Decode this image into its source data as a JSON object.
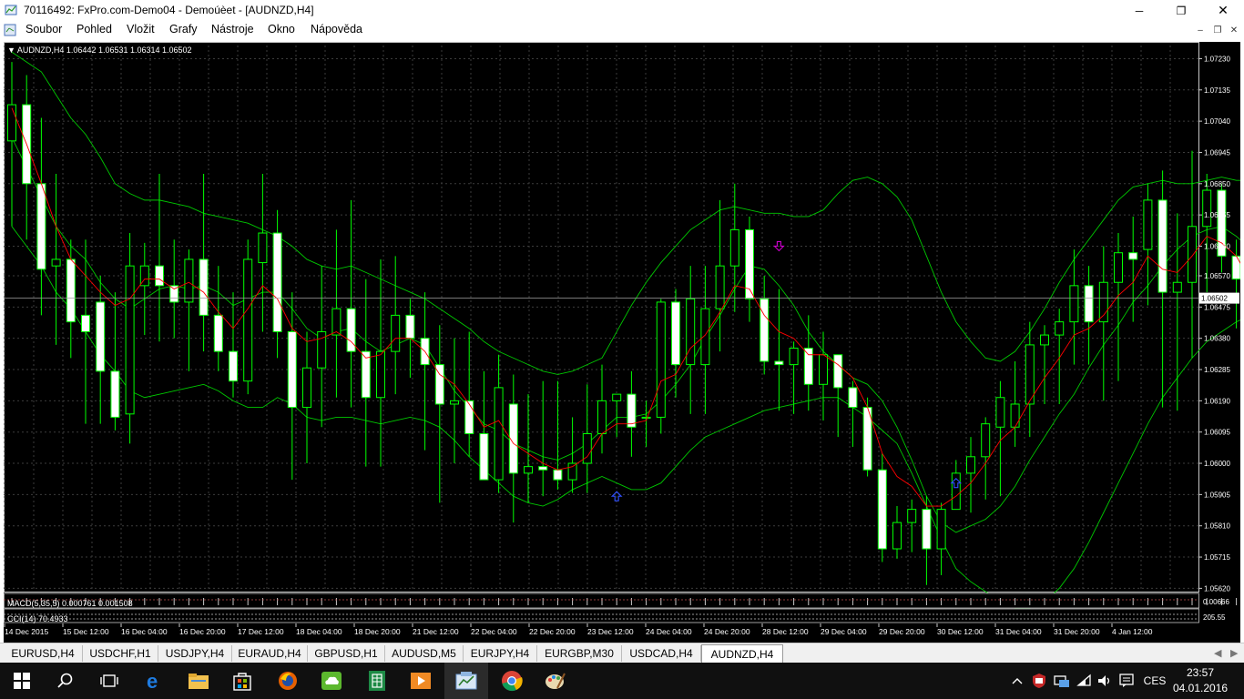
{
  "window": {
    "title": "70116492: FxPro.com-Demo04 - Demoúèet - [AUDNZD,H4]",
    "minimize": "─",
    "restore": "❐",
    "close": "✕"
  },
  "menu": {
    "items": [
      "Soubor",
      "Pohled",
      "Vložit",
      "Grafy",
      "Nástroje",
      "Okno",
      "Nápověda"
    ],
    "mdi_minimize": "–",
    "mdi_restore": "❐",
    "mdi_close": "✕"
  },
  "chart": {
    "header": "▼ AUDNZD,H4  1.06442 1.06531 1.06314 1.06502",
    "symbol": "AUDNZD",
    "timeframe": "H4",
    "ohlc": {
      "open": 1.06442,
      "high": 1.06531,
      "low": 1.06314,
      "close": 1.06502
    },
    "current_price_label": "1.06502",
    "macd_label": "MACD(5,35,5) 0.000761 0.001508",
    "cci_label": "CCI(14) 70.4933",
    "macd_scale": "0.00666",
    "cci_scale": "205.55",
    "colors": {
      "background": "#000000",
      "grid": "#3c3c3c",
      "candle": "#00ff00",
      "bull_body": "#000000",
      "bear_body": "#ffffff",
      "moving_average": "#ff0000",
      "bands": "#00c800",
      "arrow_up": "#3050ff",
      "arrow_down": "#d000d0",
      "text": "#ffffff"
    }
  },
  "chart_data": {
    "type": "candlestick",
    "title": "AUDNZD,H4",
    "y_ticks": [
      "1.07230",
      "1.07135",
      "1.07040",
      "1.06945",
      "1.06850",
      "1.06755",
      "1.06660",
      "1.06570",
      "1.06475",
      "1.06380",
      "1.06285",
      "1.06190",
      "1.06095",
      "1.06000",
      "1.05905",
      "1.05810",
      "1.05715",
      "1.05620"
    ],
    "ylim": [
      1.0561,
      1.0727
    ],
    "x_ticks": [
      "14 Dec 2015",
      "15 Dec 12:00",
      "16 Dec 04:00",
      "16 Dec 20:00",
      "17 Dec 12:00",
      "18 Dec 04:00",
      "18 Dec 20:00",
      "21 Dec 12:00",
      "22 Dec 04:00",
      "22 Dec 20:00",
      "23 Dec 12:00",
      "24 Dec 04:00",
      "24 Dec 20:00",
      "28 Dec 12:00",
      "29 Dec 04:00",
      "29 Dec 20:00",
      "30 Dec 12:00",
      "31 Dec 04:00",
      "31 Dec 20:00",
      "4 Jan 12:00"
    ],
    "candles": [
      {
        "o": 1.0698,
        "h": 1.0722,
        "l": 1.0672,
        "c": 1.0709
      },
      {
        "o": 1.0709,
        "h": 1.0718,
        "l": 1.0668,
        "c": 1.0685
      },
      {
        "o": 1.0685,
        "h": 1.0705,
        "l": 1.0645,
        "c": 1.0659
      },
      {
        "o": 1.066,
        "h": 1.0688,
        "l": 1.0636,
        "c": 1.0662
      },
      {
        "o": 1.0662,
        "h": 1.0668,
        "l": 1.0632,
        "c": 1.0643
      },
      {
        "o": 1.0645,
        "h": 1.0668,
        "l": 1.0612,
        "c": 1.064
      },
      {
        "o": 1.0649,
        "h": 1.0657,
        "l": 1.0612,
        "c": 1.0628
      },
      {
        "o": 1.0628,
        "h": 1.0652,
        "l": 1.061,
        "c": 1.0614
      },
      {
        "o": 1.0615,
        "h": 1.067,
        "l": 1.0606,
        "c": 1.066
      },
      {
        "o": 1.0654,
        "h": 1.0667,
        "l": 1.0639,
        "c": 1.066
      },
      {
        "o": 1.066,
        "h": 1.0688,
        "l": 1.0637,
        "c": 1.0654
      },
      {
        "o": 1.0654,
        "h": 1.0668,
        "l": 1.0638,
        "c": 1.0649
      },
      {
        "o": 1.0649,
        "h": 1.0665,
        "l": 1.0628,
        "c": 1.0662
      },
      {
        "o": 1.0662,
        "h": 1.0688,
        "l": 1.0634,
        "c": 1.0645
      },
      {
        "o": 1.0645,
        "h": 1.066,
        "l": 1.0628,
        "c": 1.0634
      },
      {
        "o": 1.0634,
        "h": 1.0652,
        "l": 1.062,
        "c": 1.0625
      },
      {
        "o": 1.0625,
        "h": 1.0668,
        "l": 1.0621,
        "c": 1.0662
      },
      {
        "o": 1.0661,
        "h": 1.0688,
        "l": 1.064,
        "c": 1.067
      },
      {
        "o": 1.067,
        "h": 1.0677,
        "l": 1.0632,
        "c": 1.064
      },
      {
        "o": 1.064,
        "h": 1.0652,
        "l": 1.0595,
        "c": 1.0617
      },
      {
        "o": 1.0617,
        "h": 1.064,
        "l": 1.06,
        "c": 1.0629
      },
      {
        "o": 1.0629,
        "h": 1.066,
        "l": 1.0611,
        "c": 1.064
      },
      {
        "o": 1.0639,
        "h": 1.0671,
        "l": 1.062,
        "c": 1.0647
      },
      {
        "o": 1.0647,
        "h": 1.068,
        "l": 1.0617,
        "c": 1.0634
      },
      {
        "o": 1.0634,
        "h": 1.0656,
        "l": 1.0599,
        "c": 1.062
      },
      {
        "o": 1.062,
        "h": 1.0662,
        "l": 1.0599,
        "c": 1.0634
      },
      {
        "o": 1.0634,
        "h": 1.0663,
        "l": 1.0621,
        "c": 1.0645
      },
      {
        "o": 1.0645,
        "h": 1.065,
        "l": 1.0626,
        "c": 1.0638
      },
      {
        "o": 1.0638,
        "h": 1.0652,
        "l": 1.0604,
        "c": 1.063
      },
      {
        "o": 1.063,
        "h": 1.0642,
        "l": 1.0588,
        "c": 1.0618
      },
      {
        "o": 1.0618,
        "h": 1.0638,
        "l": 1.06,
        "c": 1.0619
      },
      {
        "o": 1.0619,
        "h": 1.064,
        "l": 1.0602,
        "c": 1.0609
      },
      {
        "o": 1.0609,
        "h": 1.0628,
        "l": 1.0598,
        "c": 1.0595
      },
      {
        "o": 1.0595,
        "h": 1.0633,
        "l": 1.0591,
        "c": 1.0623
      },
      {
        "o": 1.0618,
        "h": 1.0627,
        "l": 1.0582,
        "c": 1.0597
      },
      {
        "o": 1.0597,
        "h": 1.0621,
        "l": 1.0588,
        "c": 1.0599
      },
      {
        "o": 1.0599,
        "h": 1.0625,
        "l": 1.059,
        "c": 1.0598
      },
      {
        "o": 1.0598,
        "h": 1.0625,
        "l": 1.0592,
        "c": 1.0595
      },
      {
        "o": 1.0595,
        "h": 1.0614,
        "l": 1.0591,
        "c": 1.06
      },
      {
        "o": 1.06,
        "h": 1.0624,
        "l": 1.0591,
        "c": 1.0609
      },
      {
        "o": 1.0609,
        "h": 1.063,
        "l": 1.0603,
        "c": 1.0619
      },
      {
        "o": 1.0619,
        "h": 1.0621,
        "l": 1.0608,
        "c": 1.0621
      },
      {
        "o": 1.0621,
        "h": 1.0628,
        "l": 1.0602,
        "c": 1.0611
      },
      {
        "o": 1.0614,
        "h": 1.0619,
        "l": 1.0605,
        "c": 1.0614
      },
      {
        "o": 1.0614,
        "h": 1.065,
        "l": 1.0609,
        "c": 1.0649
      },
      {
        "o": 1.0649,
        "h": 1.0653,
        "l": 1.062,
        "c": 1.063
      },
      {
        "o": 1.063,
        "h": 1.066,
        "l": 1.0615,
        "c": 1.065
      },
      {
        "o": 1.063,
        "h": 1.066,
        "l": 1.0615,
        "c": 1.0647
      },
      {
        "o": 1.0647,
        "h": 1.068,
        "l": 1.0634,
        "c": 1.066
      },
      {
        "o": 1.066,
        "h": 1.0685,
        "l": 1.0646,
        "c": 1.0671
      },
      {
        "o": 1.0671,
        "h": 1.0675,
        "l": 1.0643,
        "c": 1.065
      },
      {
        "o": 1.065,
        "h": 1.0657,
        "l": 1.0627,
        "c": 1.0631
      },
      {
        "o": 1.0631,
        "h": 1.0653,
        "l": 1.0616,
        "c": 1.063
      },
      {
        "o": 1.063,
        "h": 1.0637,
        "l": 1.0615,
        "c": 1.0635
      },
      {
        "o": 1.0635,
        "h": 1.0645,
        "l": 1.0616,
        "c": 1.0624
      },
      {
        "o": 1.0624,
        "h": 1.064,
        "l": 1.0613,
        "c": 1.0633
      },
      {
        "o": 1.0633,
        "h": 1.063,
        "l": 1.0608,
        "c": 1.0623
      },
      {
        "o": 1.0623,
        "h": 1.0625,
        "l": 1.0605,
        "c": 1.0617
      },
      {
        "o": 1.0617,
        "h": 1.062,
        "l": 1.0596,
        "c": 1.0598
      },
      {
        "o": 1.0598,
        "h": 1.0603,
        "l": 1.057,
        "c": 1.0574
      },
      {
        "o": 1.0574,
        "h": 1.0587,
        "l": 1.0571,
        "c": 1.0582
      },
      {
        "o": 1.0582,
        "h": 1.0589,
        "l": 1.0573,
        "c": 1.0586
      },
      {
        "o": 1.0586,
        "h": 1.059,
        "l": 1.0563,
        "c": 1.0574
      },
      {
        "o": 1.0574,
        "h": 1.0588,
        "l": 1.0566,
        "c": 1.0586
      },
      {
        "o": 1.0586,
        "h": 1.0601,
        "l": 1.0586,
        "c": 1.0597
      },
      {
        "o": 1.0597,
        "h": 1.0608,
        "l": 1.0585,
        "c": 1.0602
      },
      {
        "o": 1.0602,
        "h": 1.0614,
        "l": 1.0589,
        "c": 1.0612
      },
      {
        "o": 1.0611,
        "h": 1.0625,
        "l": 1.059,
        "c": 1.062
      },
      {
        "o": 1.0611,
        "h": 1.0631,
        "l": 1.0605,
        "c": 1.0618
      },
      {
        "o": 1.0618,
        "h": 1.0643,
        "l": 1.0608,
        "c": 1.0636
      },
      {
        "o": 1.0636,
        "h": 1.0642,
        "l": 1.0618,
        "c": 1.0639
      },
      {
        "o": 1.0639,
        "h": 1.0647,
        "l": 1.0618,
        "c": 1.0643
      },
      {
        "o": 1.0643,
        "h": 1.0665,
        "l": 1.063,
        "c": 1.0654
      },
      {
        "o": 1.0654,
        "h": 1.066,
        "l": 1.063,
        "c": 1.0643
      },
      {
        "o": 1.0643,
        "h": 1.0666,
        "l": 1.0619,
        "c": 1.0655
      },
      {
        "o": 1.0655,
        "h": 1.067,
        "l": 1.0625,
        "c": 1.0664
      },
      {
        "o": 1.0664,
        "h": 1.0675,
        "l": 1.0643,
        "c": 1.0662
      },
      {
        "o": 1.0665,
        "h": 1.0685,
        "l": 1.0648,
        "c": 1.068
      },
      {
        "o": 1.068,
        "h": 1.0689,
        "l": 1.0617,
        "c": 1.0652
      },
      {
        "o": 1.0652,
        "h": 1.0676,
        "l": 1.0616,
        "c": 1.0655
      },
      {
        "o": 1.0655,
        "h": 1.0695,
        "l": 1.0632,
        "c": 1.0672
      },
      {
        "o": 1.0672,
        "h": 1.0688,
        "l": 1.0652,
        "c": 1.0683
      },
      {
        "o": 1.0683,
        "h": 1.0685,
        "l": 1.0658,
        "c": 1.0663
      },
      {
        "o": 1.0663,
        "h": 1.0668,
        "l": 1.0641,
        "c": 1.0656
      },
      {
        "o": 1.0656,
        "h": 1.0654,
        "l": 1.0622,
        "c": 1.0638
      },
      {
        "o": 1.0638,
        "h": 1.0652,
        "l": 1.063,
        "c": 1.0642
      },
      {
        "o": 1.0642,
        "h": 1.0655,
        "l": 1.0628,
        "c": 1.065
      }
    ],
    "series": [
      {
        "values": [
          1.0699,
          1.069,
          1.0681,
          1.0672,
          1.0666,
          1.0662,
          1.0655,
          1.065,
          1.0647,
          1.065,
          1.0653,
          1.0654,
          1.0653,
          1.0654,
          1.0652,
          1.0648,
          1.065,
          1.0652,
          1.0652,
          1.0647,
          1.0641,
          1.0638,
          1.064,
          1.0641,
          1.0637,
          1.0634,
          1.0636,
          1.0638,
          1.0636,
          1.0629,
          1.0622,
          1.0617,
          1.0612,
          1.061,
          1.0606,
          1.0604,
          1.0602,
          1.0601,
          1.0603,
          1.0606,
          1.061,
          1.0614,
          1.0614,
          1.0615,
          1.0619,
          1.0624,
          1.063,
          1.0638,
          1.0645,
          1.0653,
          1.066,
          1.0659,
          1.0654,
          1.0648,
          1.064,
          1.0634,
          1.063,
          1.0626,
          1.0624,
          1.0619,
          1.0611,
          1.0601,
          1.059,
          1.0582,
          1.0579,
          1.0581,
          1.0583,
          1.0587,
          1.0593,
          1.0601,
          1.0608,
          1.0615,
          1.0621,
          1.0629,
          1.0636,
          1.0642,
          1.0649,
          1.0654,
          1.066,
          1.0665,
          1.0669,
          1.0671,
          1.0672,
          1.0669,
          1.0665,
          1.0659,
          1.0651
        ]
      },
      {
        "values": [
          1.0725,
          1.0722,
          1.0719,
          1.0712,
          1.0705,
          1.07,
          1.0693,
          1.0685,
          1.0682,
          1.068,
          1.068,
          1.0679,
          1.0678,
          1.0676,
          1.0675,
          1.0674,
          1.0673,
          1.0671,
          1.0669,
          1.0666,
          1.0662,
          1.066,
          1.0659,
          1.066,
          1.0658,
          1.0656,
          1.0654,
          1.0652,
          1.065,
          1.0647,
          1.0644,
          1.0641,
          1.0637,
          1.0634,
          1.0632,
          1.063,
          1.0628,
          1.0627,
          1.0628,
          1.063,
          1.0632,
          1.064,
          1.0648,
          1.0655,
          1.0661,
          1.0666,
          1.0671,
          1.0674,
          1.0677,
          1.0678,
          1.0677,
          1.0676,
          1.0676,
          1.0675,
          1.0675,
          1.0677,
          1.0682,
          1.0686,
          1.0687,
          1.0685,
          1.0681,
          1.0674,
          1.0663,
          1.0652,
          1.0643,
          1.0637,
          1.0632,
          1.0631,
          1.0634,
          1.064,
          1.0647,
          1.0655,
          1.0662,
          1.0668,
          1.0674,
          1.068,
          1.0684,
          1.0685,
          1.0686,
          1.0685,
          1.0685,
          1.0686,
          1.0687,
          1.0686,
          1.0686,
          1.0686,
          1.0685
        ]
      },
      {
        "values": [
          1.0672,
          1.0666,
          1.066,
          1.0652,
          1.0647,
          1.064,
          1.0633,
          1.0628,
          1.0622,
          1.062,
          1.0621,
          1.0622,
          1.0623,
          1.0624,
          1.0622,
          1.0619,
          1.0617,
          1.0617,
          1.062,
          1.0618,
          1.0614,
          1.0613,
          1.0614,
          1.0614,
          1.0613,
          1.0612,
          1.0613,
          1.0614,
          1.0613,
          1.0611,
          1.0607,
          1.0602,
          1.0598,
          1.0594,
          1.059,
          1.0588,
          1.0587,
          1.0589,
          1.0592,
          1.0594,
          1.0596,
          1.0594,
          1.0592,
          1.0592,
          1.0594,
          1.0599,
          1.0604,
          1.0608,
          1.061,
          1.0612,
          1.0614,
          1.0616,
          1.0617,
          1.0618,
          1.0619,
          1.062,
          1.062,
          1.0617,
          1.0614,
          1.061,
          1.0606,
          1.0597,
          1.0587,
          1.0577,
          1.0568,
          1.0564,
          1.0561,
          1.0558,
          1.0556,
          1.0556,
          1.0558,
          1.0562,
          1.0568,
          1.0576,
          1.0585,
          1.0594,
          1.0603,
          1.0612,
          1.062,
          1.0626,
          1.0632,
          1.0637,
          1.064,
          1.0643,
          1.0645,
          1.0645,
          1.0645
        ]
      },
      {
        "values": [
          1.0708,
          1.0697,
          1.0685,
          1.0672,
          1.0662,
          1.0657,
          1.0652,
          1.0648,
          1.065,
          1.0656,
          1.0656,
          1.0653,
          1.0655,
          1.0652,
          1.0646,
          1.0641,
          1.0647,
          1.0654,
          1.065,
          1.0641,
          1.0637,
          1.0638,
          1.064,
          1.0637,
          1.0632,
          1.0633,
          1.0638,
          1.0638,
          1.0634,
          1.0627,
          1.0624,
          1.0618,
          1.0611,
          1.0613,
          1.0606,
          1.0603,
          1.06,
          1.0598,
          1.0599,
          1.0602,
          1.0609,
          1.0612,
          1.0612,
          1.0613,
          1.0625,
          1.0627,
          1.0635,
          1.0639,
          1.0646,
          1.0654,
          1.0653,
          1.0645,
          1.064,
          1.0638,
          1.0633,
          1.0633,
          1.063,
          1.0626,
          1.0617,
          1.0603,
          1.0596,
          1.0593,
          1.0587,
          1.0587,
          1.059,
          1.0594,
          1.06,
          1.0607,
          1.0611,
          1.0619,
          1.0626,
          1.0632,
          1.0639,
          1.0641,
          1.0645,
          1.0651,
          1.0655,
          1.0663,
          1.0659,
          1.0658,
          1.0663,
          1.0669,
          1.0667,
          1.0663,
          1.0655,
          1.065,
          1.065
        ]
      }
    ],
    "arrows": [
      {
        "type": "up",
        "index": 41,
        "price": 1.059
      },
      {
        "type": "down",
        "index": 52,
        "price": 1.0666
      },
      {
        "type": "up",
        "index": 64,
        "price": 1.0594
      }
    ]
  },
  "tabs": {
    "items": [
      "EURUSD,H4",
      "USDCHF,H1",
      "USDJPY,H4",
      "EURAUD,H4",
      "GBPUSD,H1",
      "AUDUSD,M5",
      "EURJPY,H4",
      "EURGBP,M30",
      "USDCAD,H4",
      "AUDNZD,H4"
    ],
    "active": "AUDNZD,H4",
    "nav_left": "◀",
    "nav_right": "▶"
  },
  "taskbar": {
    "apps": [
      "start-icon",
      "search-icon",
      "task-view-icon",
      "edge-icon",
      "file-explorer-icon",
      "store-icon",
      "firefox-icon",
      "cloud-app-icon",
      "excel-icon",
      "media-app-icon",
      "metatrader-icon",
      "chrome-icon",
      "paint-icon"
    ],
    "language": "CES",
    "time": "23:57",
    "date": "04.01.2016"
  }
}
